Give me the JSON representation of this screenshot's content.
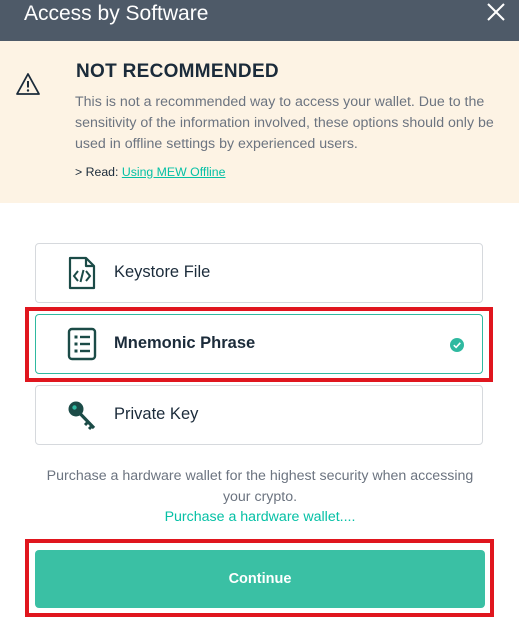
{
  "header": {
    "title": "Access by Software",
    "close_icon": "close-icon"
  },
  "warning": {
    "icon": "warning-triangle-icon",
    "title": "NOT RECOMMENDED",
    "body": "This is not a recommended way to access your wallet. Due to the sensitivity of the information involved, these options should only be used in offline settings by experienced users.",
    "read_prefix": "> Read: ",
    "read_link": "Using MEW Offline"
  },
  "options": [
    {
      "label": "Keystore File",
      "icon": "keystore-file-icon",
      "selected": false
    },
    {
      "label": "Mnemonic Phrase",
      "icon": "mnemonic-list-icon",
      "selected": true
    },
    {
      "label": "Private Key",
      "icon": "key-icon",
      "selected": false
    }
  ],
  "promo": {
    "text": "Purchase a hardware wallet for the highest security when accessing your crypto.",
    "link": "Purchase a hardware wallet...."
  },
  "continue_label": "Continue",
  "colors": {
    "accent": "#05c0a5",
    "button": "#3ac0a4",
    "header": "#4e5a68",
    "highlight": "#e0161e"
  }
}
